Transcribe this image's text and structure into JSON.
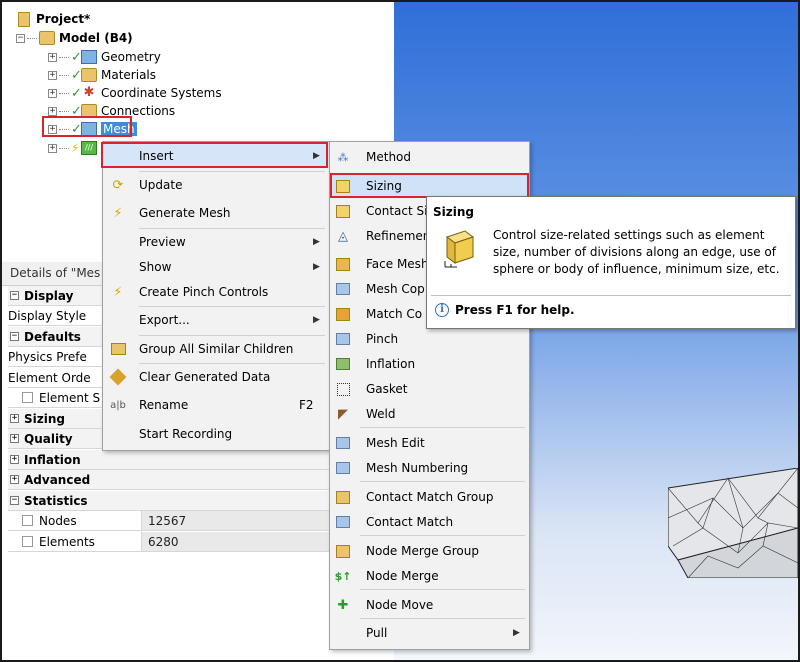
{
  "tree": {
    "project": "Project*",
    "model": "Model (B4)",
    "items": [
      {
        "label": "Geometry"
      },
      {
        "label": "Materials"
      },
      {
        "label": "Coordinate Systems"
      },
      {
        "label": "Connections"
      },
      {
        "label": "Mesh"
      }
    ]
  },
  "details": {
    "title": "Details of \"Mes",
    "rows": [
      {
        "label": "Display",
        "type": "category"
      },
      {
        "label": "Display Style",
        "type": "property"
      },
      {
        "label": "Defaults",
        "type": "category"
      },
      {
        "label": "Physics Prefe",
        "type": "property"
      },
      {
        "label": "Element Orde",
        "type": "property"
      },
      {
        "label": "Element S",
        "type": "checkbox"
      },
      {
        "label": "Sizing",
        "type": "category"
      },
      {
        "label": "Quality",
        "type": "category"
      },
      {
        "label": "Inflation",
        "type": "category"
      },
      {
        "label": "Advanced",
        "type": "category"
      },
      {
        "label": "Statistics",
        "type": "category"
      },
      {
        "label": "Nodes",
        "value": "12567",
        "type": "checkbox"
      },
      {
        "label": "Elements",
        "value": "6280",
        "type": "checkbox"
      }
    ]
  },
  "context_menu": {
    "insert": "Insert",
    "update": "Update",
    "generate_mesh": "Generate Mesh",
    "preview": "Preview",
    "show": "Show",
    "create_pinch": "Create Pinch Controls",
    "export": "Export...",
    "group_similar": "Group All Similar Children",
    "clear_data": "Clear Generated Data",
    "rename": "Rename",
    "rename_shortcut": "F2",
    "start_recording": "Start Recording"
  },
  "submenu": {
    "items": [
      {
        "label": "Method",
        "icon": "method-icon"
      },
      {
        "label": "Sizing",
        "icon": "sizing-icon"
      },
      {
        "label": "Contact Si",
        "icon": "contact-sizing-icon"
      },
      {
        "label": "Refinemen",
        "icon": "refinement-icon"
      },
      {
        "label": "Face Mesh",
        "icon": "face-meshing-icon"
      },
      {
        "label": "Mesh Cop",
        "icon": "mesh-copy-icon"
      },
      {
        "label": "Match Co",
        "icon": "match-control-icon"
      },
      {
        "label": "Pinch",
        "icon": "pinch-icon"
      },
      {
        "label": "Inflation",
        "icon": "inflation-icon"
      },
      {
        "label": "Gasket",
        "icon": "gasket-icon"
      },
      {
        "label": "Weld",
        "icon": "weld-icon"
      },
      {
        "label": "Mesh Edit",
        "icon": "mesh-edit-icon"
      },
      {
        "label": "Mesh Numbering",
        "icon": "mesh-numbering-icon"
      },
      {
        "label": "Contact Match Group",
        "icon": "contact-match-group-icon"
      },
      {
        "label": "Contact Match",
        "icon": "contact-match-icon"
      },
      {
        "label": "Node Merge Group",
        "icon": "node-merge-group-icon"
      },
      {
        "label": "Node Merge",
        "icon": "node-merge-icon"
      },
      {
        "label": "Node Move",
        "icon": "node-move-icon"
      },
      {
        "label": "Pull",
        "icon": "pull-icon"
      }
    ]
  },
  "tooltip": {
    "title": "Sizing",
    "body": "Control size-related settings such as element size, number of divisions along an edge, use of sphere or body of influence, minimum size, etc.",
    "help": "Press F1 for help."
  },
  "colors": {
    "selection": "#3d8ce0",
    "highlight_box": "#d9232d",
    "menu_bg": "#f2f2f2",
    "viewport_top": "#2f6fd8"
  }
}
